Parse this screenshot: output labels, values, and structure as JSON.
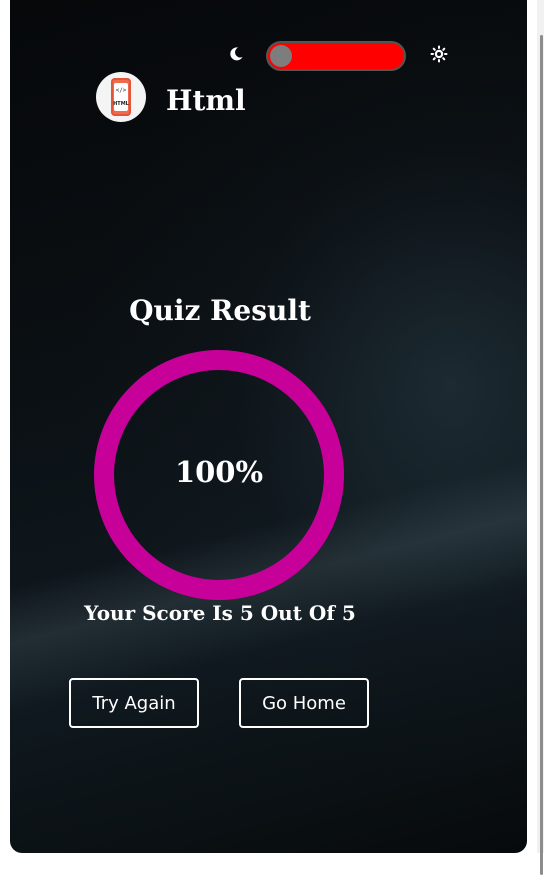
{
  "header": {
    "theme_toggle": {
      "dark_icon": "moon-icon",
      "light_icon": "sun-icon",
      "track_color": "#ff0000",
      "knob_color": "#7d7d7d"
    },
    "quiz_logo": {
      "icon": "html-file-icon",
      "code_glyph": "</>",
      "label": "HTML"
    },
    "quiz_name": "Html"
  },
  "result": {
    "title": "Quiz Result",
    "percent_label": "100%",
    "percent_value": 100,
    "ring_color": "#c8009a",
    "score_text": "Your Score Is 5 Out Of 5"
  },
  "actions": {
    "try_again_label": "Try Again",
    "go_home_label": "Go Home"
  }
}
